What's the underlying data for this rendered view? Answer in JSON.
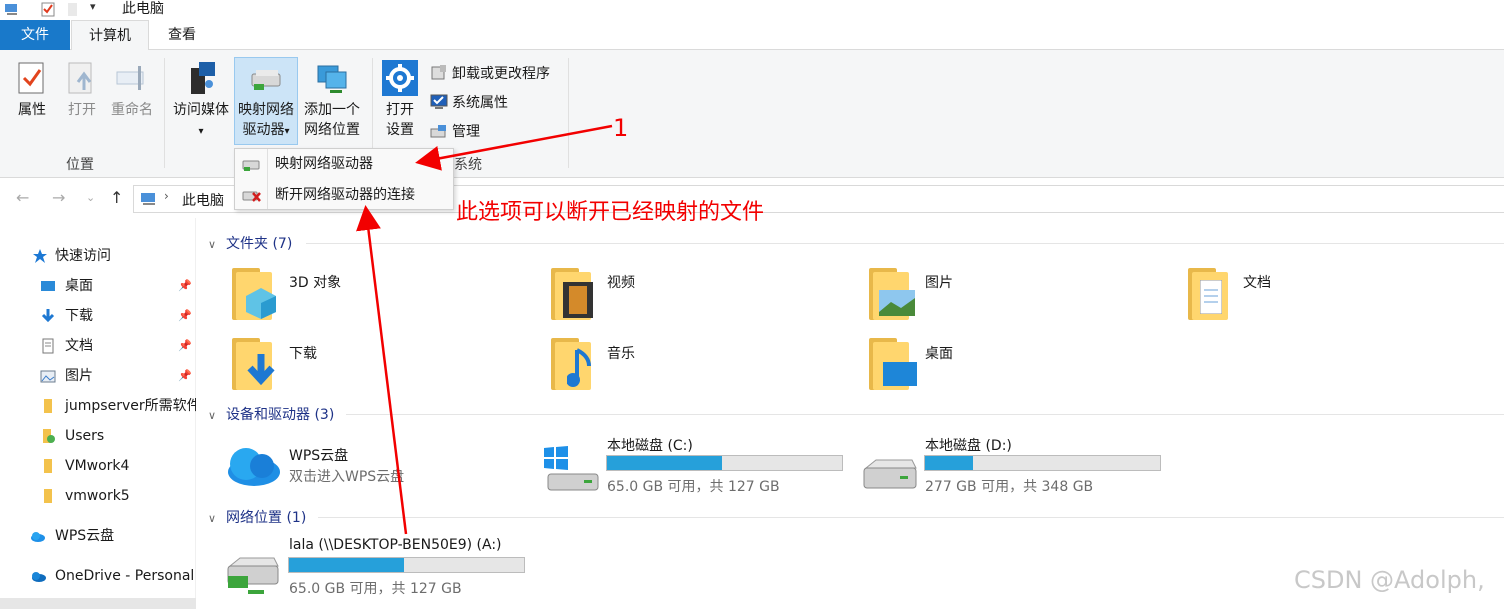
{
  "window": {
    "title": "此电脑"
  },
  "tabs": {
    "file": "文件",
    "computer": "计算机",
    "view": "查看"
  },
  "ribbon": {
    "location_group": "位置",
    "properties": "属性",
    "open": "打开",
    "rename": "重命名",
    "access_media": "访问媒体",
    "map_drive_line1": "映射网络",
    "map_drive_line2": "驱动器",
    "add_location_line1": "添加一个",
    "add_location_line2": "网络位置",
    "open_settings_line1": "打开",
    "open_settings_line2": "设置",
    "uninstall": "卸载或更改程序",
    "system_properties": "系统属性",
    "manage": "管理",
    "system_group": "系统"
  },
  "dropdown": {
    "map_drive": "映射网络驱动器",
    "disconnect_drive": "断开网络驱动器的连接"
  },
  "address": {
    "path": "此电脑"
  },
  "sidebar": {
    "quick_access": "快速访问",
    "desktop": "桌面",
    "downloads": "下载",
    "documents": "文档",
    "pictures": "图片",
    "jumpserver": "jumpserver所需软件",
    "users": "Users",
    "vmwork4": "VMwork4",
    "vmwork5": "vmwork5",
    "wps_cloud": "WPS云盘",
    "onedrive": "OneDrive - Personal"
  },
  "folders": {
    "header": "文件夹 (7)",
    "objects3d": "3D 对象",
    "videos": "视频",
    "pictures": "图片",
    "documents": "文档",
    "downloads": "下载",
    "music": "音乐",
    "desktop": "桌面"
  },
  "devices": {
    "header": "设备和驱动器 (3)",
    "wps_name": "WPS云盘",
    "wps_sub": "双击进入WPS云盘",
    "c_name": "本地磁盘 (C:)",
    "c_sub": "65.0 GB 可用，共 127 GB",
    "c_used": 0.488,
    "d_name": "本地磁盘 (D:)",
    "d_sub": "277 GB 可用，共 348 GB",
    "d_used": 0.204
  },
  "network": {
    "header": "网络位置 (1)",
    "name": "lala (\\\\DESKTOP-BEN50E9) (A:)",
    "sub": "65.0 GB 可用，共 127 GB",
    "used": 0.488
  },
  "annotations": {
    "note": "此选项可以断开已经映射的文件",
    "number": "1"
  },
  "watermark": "CSDN @Adolph,",
  "colors": {
    "accent": "#1979ca",
    "bar_fill": "#26a0da",
    "annotation": "#f20000"
  }
}
